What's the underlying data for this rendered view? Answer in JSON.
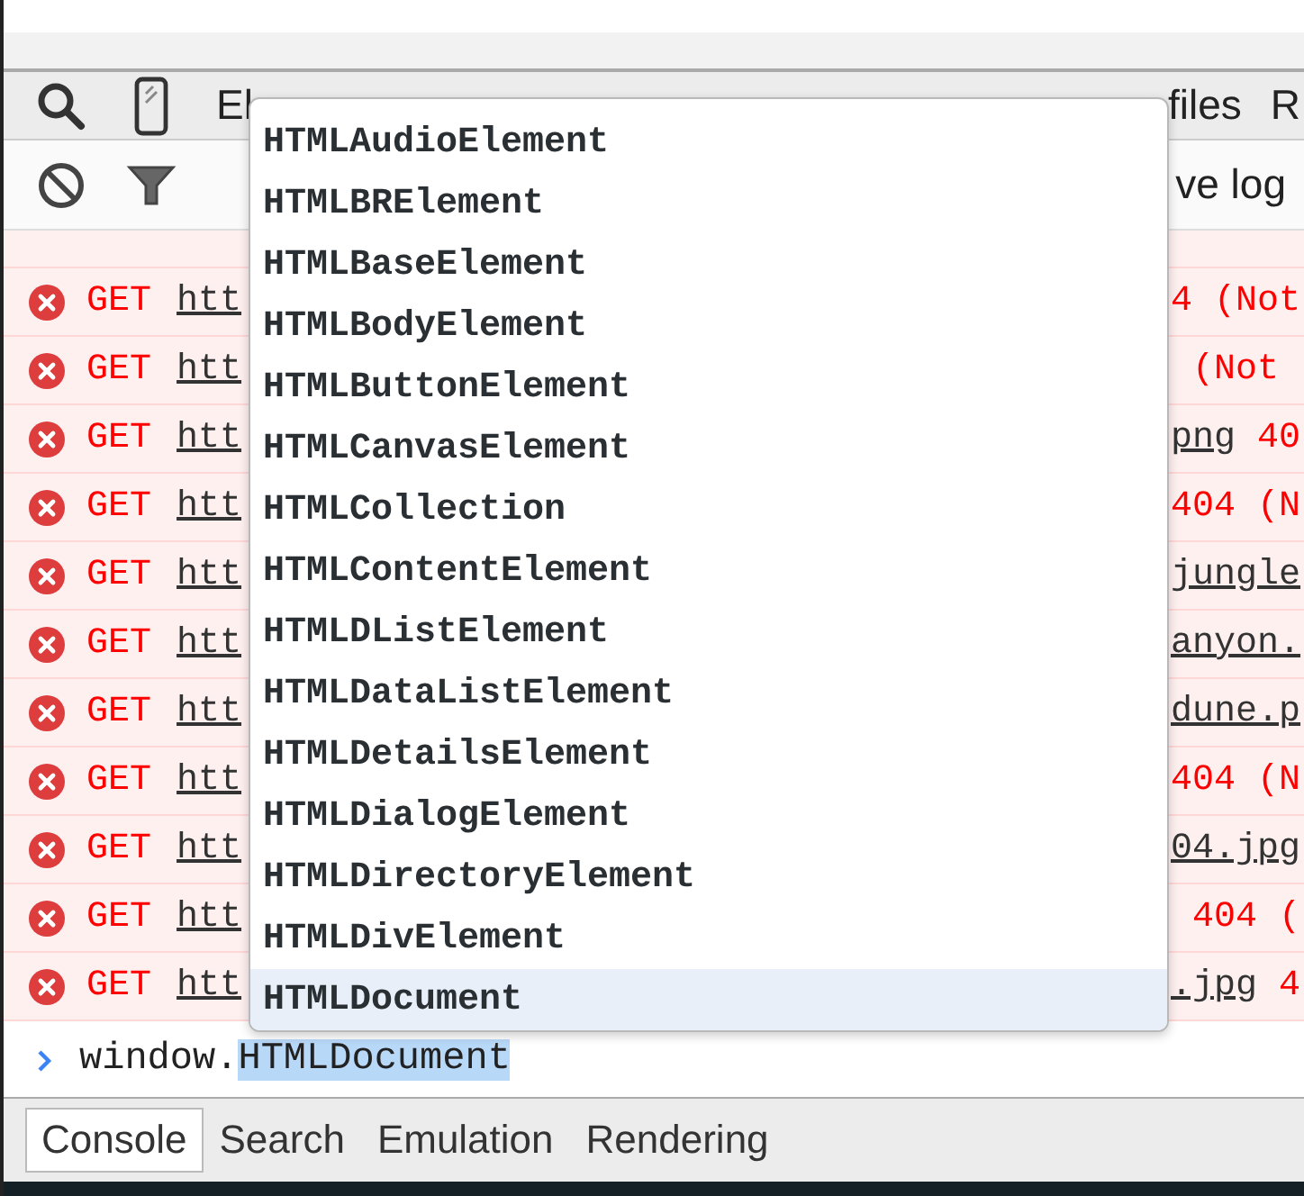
{
  "panel_tabs": {
    "left": [
      {
        "label": "El"
      }
    ],
    "right": [
      {
        "label": "files"
      },
      {
        "label": "R"
      }
    ]
  },
  "console_toolbar": {
    "right_text": "ve log"
  },
  "log_rows": [
    {
      "method": "GET",
      "url": "htt",
      "tail": [
        {
          "kind": "status",
          "text": "4 (Not"
        }
      ]
    },
    {
      "method": "GET",
      "url": "htt",
      "tail": [
        {
          "kind": "status",
          "text": " (Not"
        }
      ]
    },
    {
      "method": "GET",
      "url": "htt",
      "tail": [
        {
          "kind": "link",
          "text": "png"
        },
        {
          "kind": "status",
          "text": " 40"
        }
      ]
    },
    {
      "method": "GET",
      "url": "htt",
      "tail": [
        {
          "kind": "status",
          "text": "404 (N"
        }
      ]
    },
    {
      "method": "GET",
      "url": "htt",
      "tail": [
        {
          "kind": "link",
          "text": "jungle"
        }
      ]
    },
    {
      "method": "GET",
      "url": "htt",
      "tail": [
        {
          "kind": "link",
          "text": "anyon."
        }
      ]
    },
    {
      "method": "GET",
      "url": "htt",
      "tail": [
        {
          "kind": "link",
          "text": "dune.p"
        }
      ]
    },
    {
      "method": "GET",
      "url": "htt",
      "tail": [
        {
          "kind": "status",
          "text": "404 (N"
        }
      ]
    },
    {
      "method": "GET",
      "url": "htt",
      "tail": [
        {
          "kind": "link",
          "text": "04.jpg"
        }
      ]
    },
    {
      "method": "GET",
      "url": "htt",
      "tail": [
        {
          "kind": "status",
          "text": " 404 ("
        }
      ]
    },
    {
      "method": "GET",
      "url": "htt",
      "tail": [
        {
          "kind": "link",
          "text": ".jpg"
        },
        {
          "kind": "status",
          "text": " 4"
        }
      ]
    }
  ],
  "autocomplete": [
    {
      "label": "HTMLAudioElement",
      "selected": false
    },
    {
      "label": "HTMLBRElement",
      "selected": false
    },
    {
      "label": "HTMLBaseElement",
      "selected": false
    },
    {
      "label": "HTMLBodyElement",
      "selected": false
    },
    {
      "label": "HTMLButtonElement",
      "selected": false
    },
    {
      "label": "HTMLCanvasElement",
      "selected": false
    },
    {
      "label": "HTMLCollection",
      "selected": false
    },
    {
      "label": "HTMLContentElement",
      "selected": false
    },
    {
      "label": "HTMLDListElement",
      "selected": false
    },
    {
      "label": "HTMLDataListElement",
      "selected": false
    },
    {
      "label": "HTMLDetailsElement",
      "selected": false
    },
    {
      "label": "HTMLDialogElement",
      "selected": false
    },
    {
      "label": "HTMLDirectoryElement",
      "selected": false
    },
    {
      "label": "HTMLDivElement",
      "selected": false
    },
    {
      "label": "HTMLDocument",
      "selected": true
    }
  ],
  "prompt": {
    "typed": "window.",
    "completion": "HTMLDocument"
  },
  "drawer_tabs": [
    {
      "label": "Console",
      "selected": true
    },
    {
      "label": "Search",
      "selected": false
    },
    {
      "label": "Emulation",
      "selected": false
    },
    {
      "label": "Rendering",
      "selected": false
    }
  ]
}
